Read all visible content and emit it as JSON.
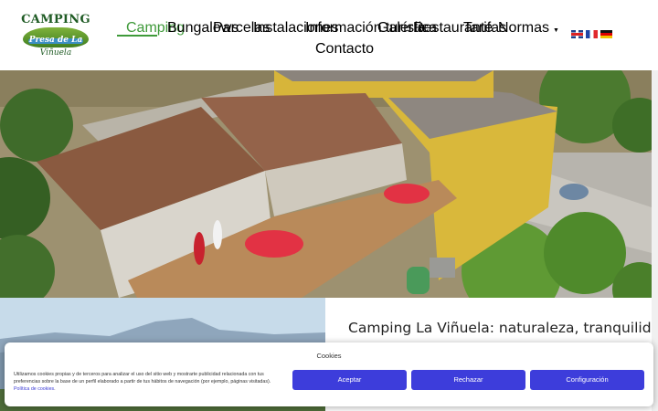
{
  "logo": {
    "top": "CAMPING",
    "middle": "Presa de La",
    "bottom": "Viñuela"
  },
  "nav": {
    "items": [
      {
        "label": "Camping"
      },
      {
        "label": "Bungalows"
      },
      {
        "label": "Parcelas"
      },
      {
        "label": "Instalaciones"
      },
      {
        "label": "Información turística"
      },
      {
        "label": "Galería"
      },
      {
        "label": "Restaurante"
      },
      {
        "label": "Tarifas"
      },
      {
        "label": "Normas"
      },
      {
        "label": "Contacto"
      }
    ],
    "active": "Camping",
    "accent_color": "#3f9a3a"
  },
  "languages": [
    "English",
    "Français",
    "Deutsch"
  ],
  "hero": {
    "icon": "aerial-photo-restaurant-terrace"
  },
  "section2": {
    "headline": "Camping La Viñuela: naturaleza, tranquilidad y",
    "photo_icon": "mountain-lake-photo"
  },
  "cookie": {
    "title": "Cookies",
    "text": "Utilizamos cookies propias y de terceros para analizar el uso del sitio web y mostrarte publicidad relacionada con tus preferencias sobre la base de un perfil elaborado a partir de tus hábitos de navegación (por ejemplo, páginas visitadas).",
    "link": "Política de cookies",
    "accept": "Aceptar",
    "reject": "Rechazar",
    "config": "Configuración",
    "button_color": "#3d3ddb"
  }
}
